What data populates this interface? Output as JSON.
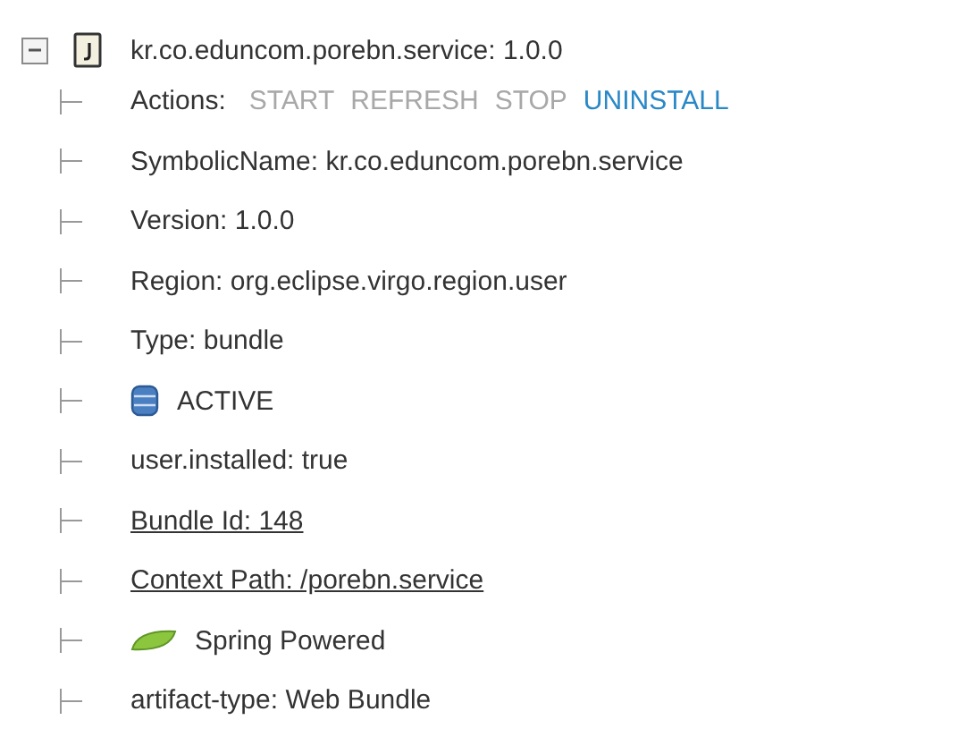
{
  "tree": {
    "label": "kr.co.eduncom.porebn.service: 1.0.0",
    "expanded": true,
    "children": [
      {
        "kind": "actions",
        "label": "Actions:",
        "actions": [
          {
            "label": "START",
            "disabled": true
          },
          {
            "label": "REFRESH",
            "disabled": true
          },
          {
            "label": "STOP",
            "disabled": true
          },
          {
            "label": "UNINSTALL",
            "disabled": false
          }
        ]
      },
      {
        "kind": "text",
        "label": "SymbolicName: kr.co.eduncom.porebn.service"
      },
      {
        "kind": "text",
        "label": "Version: 1.0.0"
      },
      {
        "kind": "text",
        "label": "Region: org.eclipse.virgo.region.user"
      },
      {
        "kind": "text",
        "label": "Type: bundle"
      },
      {
        "kind": "state",
        "label": "ACTIVE"
      },
      {
        "kind": "text",
        "label": "user.installed: true"
      },
      {
        "kind": "link",
        "label": "Bundle Id: 148"
      },
      {
        "kind": "link",
        "label": "Context Path: /porebn.service"
      },
      {
        "kind": "spring",
        "label": "Spring Powered"
      },
      {
        "kind": "text",
        "label": "artifact-type: Web Bundle"
      }
    ]
  }
}
